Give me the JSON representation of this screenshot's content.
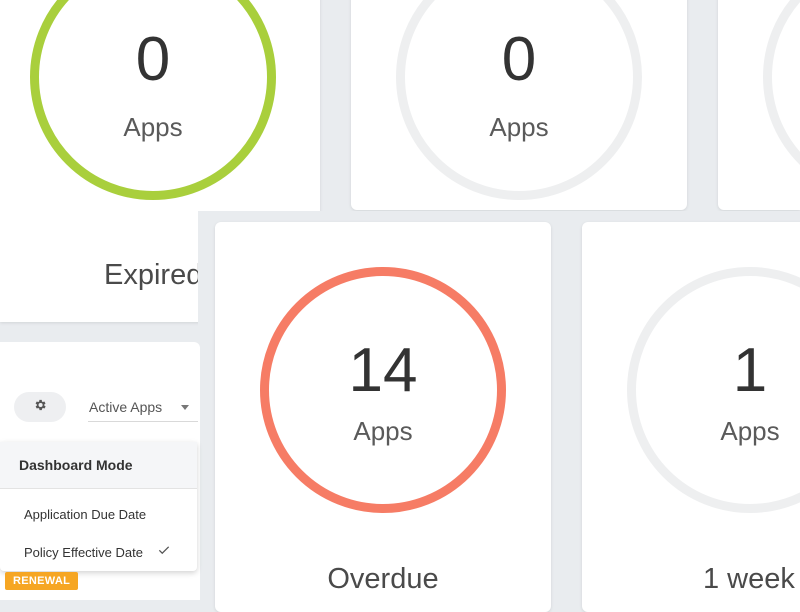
{
  "cards": [
    {
      "count": "0",
      "unit": "Apps",
      "status": "Expired",
      "ring_color": "#a9cf3c"
    },
    {
      "count": "0",
      "unit": "Apps",
      "status": "",
      "ring_color": "#eeeff0"
    },
    {
      "count": "",
      "unit": "",
      "status": "",
      "ring_color": "#eeeff0"
    },
    {
      "count": "14",
      "unit": "Apps",
      "status": "Overdue",
      "ring_color": "#f67c65"
    },
    {
      "count": "1",
      "unit": "Apps",
      "status": "1 week",
      "ring_color": "#eeeff0"
    }
  ],
  "controls": {
    "settings_icon": "gear-icon",
    "view_select": {
      "value": "Active Apps"
    }
  },
  "menu": {
    "header": "Dashboard Mode",
    "items": [
      {
        "label": "Application Due Date",
        "selected": false
      },
      {
        "label": "Policy Effective Date",
        "selected": true
      }
    ]
  },
  "badge": {
    "label": "RENEWAL",
    "color": "#f6a623"
  }
}
